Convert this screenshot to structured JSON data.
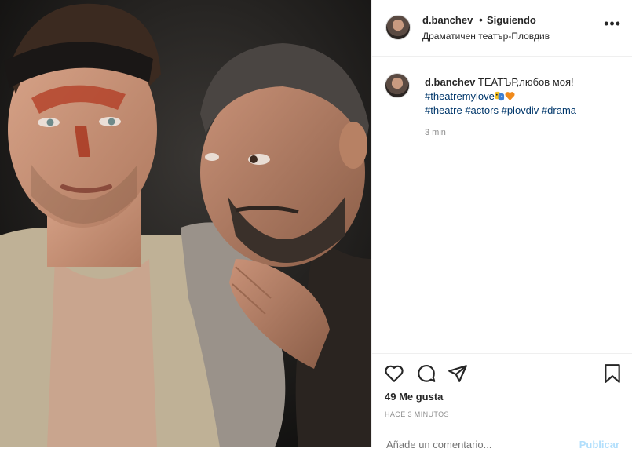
{
  "post": {
    "image_alt": "Two actors in costume on stage",
    "header": {
      "username": "d.banchev",
      "separator": "•",
      "follow_label": "Siguiendo",
      "location": "Драматичен театър-Пловдив",
      "more": "•••"
    },
    "caption": {
      "username": "d.banchev",
      "text": "ТЕАТЪР,любов моя!",
      "hashtag_line1": "#theatremylove",
      "hashtags": [
        "#theatre",
        "#actors",
        "#plovdiv",
        "#drama"
      ],
      "time": "3 min"
    },
    "actions": {
      "likes": "49 Me gusta",
      "posted_ago": "HACE 3 MINUTOS"
    },
    "add_comment": {
      "placeholder": "Añade un comentario...",
      "publish_label": "Publicar"
    }
  },
  "colors": {
    "hashtag": "#00376b",
    "secondary_text": "#8e8e8e",
    "publish_disabled": "#b2dffc",
    "heart_emoji": "#f08a1c"
  },
  "icons": [
    "more-icon",
    "heart-icon",
    "comment-bubble-icon",
    "share-plane-icon",
    "bookmark-icon",
    "theatre-masks-icon",
    "orange-heart-icon"
  ]
}
